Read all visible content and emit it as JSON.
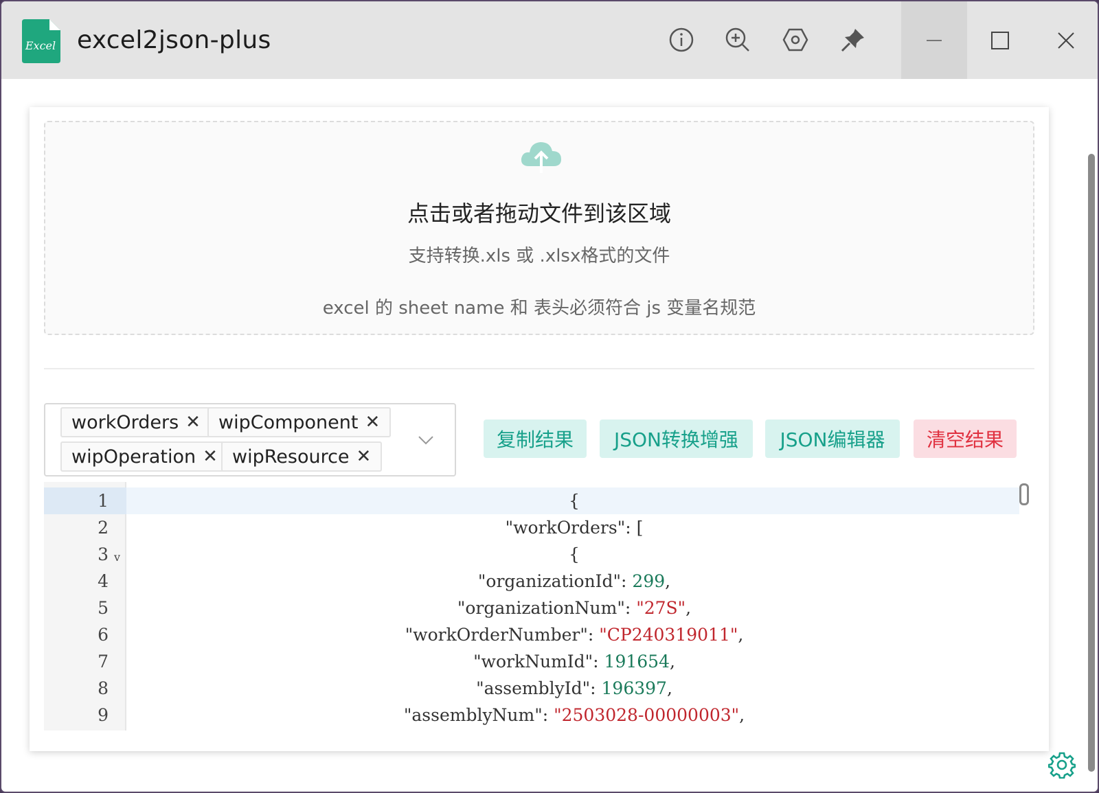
{
  "app": {
    "title": "excel2json-plus",
    "logo_text": "Excel"
  },
  "titlebar": {
    "icons": [
      "info-icon",
      "zoom-in-icon",
      "settings-hex-icon",
      "pin-icon"
    ],
    "window_controls": [
      "minimize",
      "maximize",
      "close"
    ]
  },
  "dropzone": {
    "title": "点击或者拖动文件到该区域",
    "hint": "支持转换.xls 或 .xlsx格式的文件",
    "hint2": "excel 的 sheet name 和 表头必须符合 js 变量名规范",
    "icon": "cloud-upload-icon"
  },
  "sheet_select": {
    "tags": [
      "workOrders",
      "wipComponent",
      "wipOperation",
      "wipResource"
    ],
    "remove_glyph": "✕"
  },
  "actions": {
    "copy": "复制结果",
    "json_enhance": "JSON转换增强",
    "json_editor": "JSON编辑器",
    "clear": "清空结果"
  },
  "editor": {
    "lines": [
      {
        "num": "1",
        "key": "",
        "value": "",
        "punct": "{"
      },
      {
        "num": "2",
        "key": "\"workOrders\"",
        "value": "",
        "punct": ": ["
      },
      {
        "num": "3",
        "key": "",
        "value": "",
        "punct": "{",
        "fold": "v"
      },
      {
        "num": "4",
        "key": "\"organizationId\"",
        "value": "299",
        "vtype": "n",
        "punct": ","
      },
      {
        "num": "5",
        "key": "\"organizationNum\"",
        "value": "\"27S\"",
        "vtype": "s",
        "punct": ","
      },
      {
        "num": "6",
        "key": "\"workOrderNumber\"",
        "value": "\"CP240319011\"",
        "vtype": "s",
        "punct": ","
      },
      {
        "num": "7",
        "key": "\"workNumId\"",
        "value": "191654",
        "vtype": "n",
        "punct": ","
      },
      {
        "num": "8",
        "key": "\"assemblyId\"",
        "value": "196397",
        "vtype": "n",
        "punct": ","
      },
      {
        "num": "9",
        "key": "\"assemblyNum\"",
        "value": "\"2503028-00000003\"",
        "vtype": "s",
        "punct": ","
      }
    ]
  },
  "colors": {
    "accent_teal": "#17a08a",
    "teal_bg": "#d8f3ef",
    "danger": "#e0303f",
    "danger_bg": "#fbdde2",
    "string": "#c0262d",
    "number": "#1a7a5a"
  }
}
